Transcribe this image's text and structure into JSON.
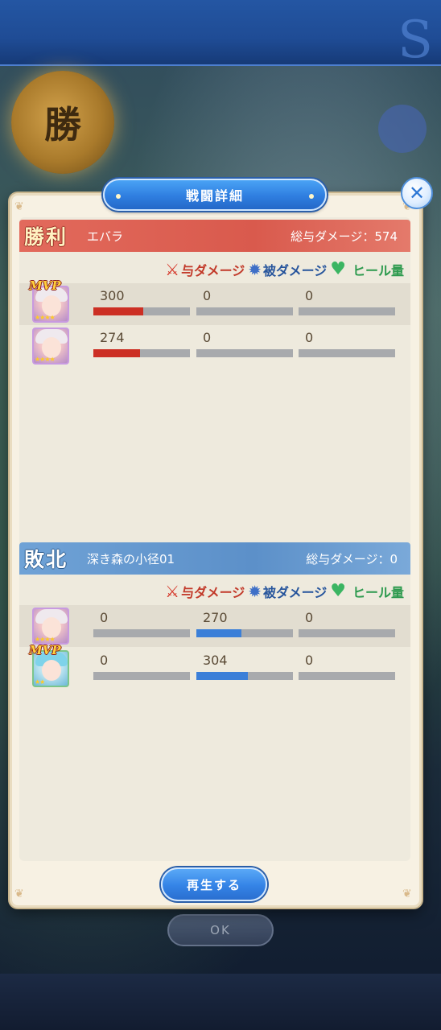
{
  "background": {
    "win_emblem_text": "勝",
    "ok_label": "OK"
  },
  "modal": {
    "title": "戦闘詳細",
    "close_icon": "close-icon",
    "replay_label": "再生する"
  },
  "legend": {
    "damage_dealt": "与ダメージ",
    "damage_taken": "被ダメージ",
    "heal": "ヒール量",
    "damage_dealt_icon": "sword-icon",
    "damage_taken_icon": "bomb-icon",
    "heal_icon": "heart-icon"
  },
  "teams": [
    {
      "result": "勝利",
      "name": "エバラ",
      "total": "総与ダメージ：574",
      "accent": "#d95a4d",
      "units": [
        {
          "mvp": "MVP",
          "stars": "★★★★",
          "damage": "300",
          "damage_ratio": 0.52,
          "taken": "0",
          "taken_ratio": 0,
          "heal": "0",
          "heal_ratio": 0
        },
        {
          "mvp": "",
          "stars": "★★★★",
          "damage": "274",
          "damage_ratio": 0.48,
          "taken": "0",
          "taken_ratio": 0,
          "heal": "0",
          "heal_ratio": 0
        }
      ]
    },
    {
      "result": "敗北",
      "name": "深き森の小径01",
      "total": "総与ダメージ：0",
      "accent": "#5c90c9",
      "units": [
        {
          "mvp": "",
          "stars": "★★★★",
          "damage": "0",
          "damage_ratio": 0,
          "taken": "270",
          "taken_ratio": 0.47,
          "heal": "0",
          "heal_ratio": 0
        },
        {
          "mvp": "MVP",
          "stars": "★★",
          "damage": "0",
          "damage_ratio": 0,
          "taken": "304",
          "taken_ratio": 0.53,
          "heal": "0",
          "heal_ratio": 0
        }
      ]
    }
  ]
}
